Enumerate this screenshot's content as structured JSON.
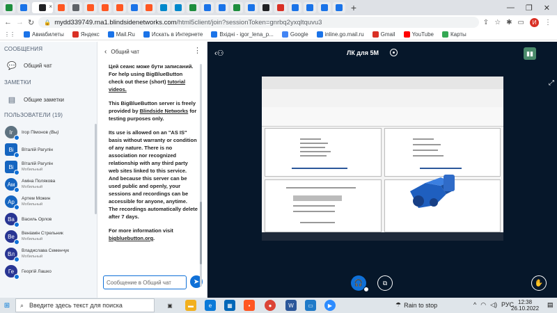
{
  "browser": {
    "url_host": "mydd339749.rna1.blindsidenetworks.com",
    "url_path": "/html5client/join?sessionToken=gnrbq2yxqltquvu3",
    "bookmarks": [
      "Авиабилеты",
      "Яндекс",
      "Mail.Ru",
      "Искать в Интернете",
      "Вхідні - igor_lena_p...",
      "Google",
      "inline.go.mail.ru",
      "Gmail",
      "YouTube",
      "Карты"
    ],
    "profile_initial": "И",
    "tab_colors": [
      "#1e8e3e",
      "#1a73e8",
      "#202124",
      "#ff5722",
      "#5f6368",
      "#ff5722",
      "#ff5722",
      "#ff5722",
      "#1a73e8",
      "#ff5722",
      "#0088cc",
      "#0088cc",
      "#1e8e3e",
      "#1a73e8",
      "#1a73e8",
      "#1e8e3e",
      "#1a73e8",
      "#202124",
      "#d93025",
      "#1a73e8",
      "#1a73e8",
      "#1a73e8",
      "#1a73e8"
    ]
  },
  "sidebar": {
    "messages_header": "СООБЩЕНИЯ",
    "public_chat_label": "Общий чат",
    "notes_header": "ЗАМЕТКИ",
    "shared_notes_label": "Общие заметки",
    "users_header": "ПОЛЬЗОВАТЕЛИ (19)",
    "users": [
      {
        "initials": "Ir",
        "name": "Ігор Пімонов",
        "you": "(Вы)",
        "sub": "",
        "color": "#5e7280",
        "square": false
      },
      {
        "initials": "Ві",
        "name": "Віталій Рагулін",
        "sub": "",
        "color": "#1565c0",
        "square": true
      },
      {
        "initials": "Ві",
        "name": "Віталій Рагулін",
        "sub": "Мобильный",
        "color": "#1565c0",
        "square": true
      },
      {
        "initials": "Ам",
        "name": "Аміна Полякова",
        "sub": "Мобильный",
        "color": "#1565c0",
        "square": false
      },
      {
        "initials": "Ар",
        "name": "Артем Можин",
        "sub": "Мобильный",
        "color": "#1565c0",
        "square": false
      },
      {
        "initials": "Ва",
        "name": "Василь Орлов",
        "sub": "",
        "color": "#283593",
        "square": false
      },
      {
        "initials": "Ве",
        "name": "Веніамін Стрельник",
        "sub": "Мобильный",
        "color": "#283593",
        "square": false
      },
      {
        "initials": "Вл",
        "name": "Владислава Семенчук",
        "sub": "Мобильный",
        "color": "#283593",
        "square": false
      },
      {
        "initials": "Ге",
        "name": "Георгій Лашко",
        "sub": "",
        "color": "#283593",
        "square": false
      }
    ]
  },
  "chat": {
    "title": "Общий чат",
    "msg_line1": "Цей сеанс може бути записаний.",
    "msg_line1b": "For help using BigBlueButton check out these (short)",
    "tutorial_link": "tutorial videos.",
    "msg2a": "This BigBlueButton server is freely provided by",
    "blindside_link": "Blindside Networks",
    "msg2b": "for testing purposes only.",
    "msg3": "Its use is allowed on an \"AS IS\" basis without warranty or condition of any nature. There is no association nor recognized relationship with any third party web sites linked to this service. And because this server can be used public and openly, your sessions and recordings can be accessible for anyone, anytime. The recordings automatically delete after 7 days.",
    "msg4": "For more information visit",
    "bbb_link": "bigbluebutton.org",
    "input_placeholder": "Сообщение в Общий чат"
  },
  "main": {
    "room_name": "ЛК для 5М"
  },
  "taskbar": {
    "search_placeholder": "Введите здесь текст для поиска",
    "weather": "Rain to stop",
    "lang": "РУС",
    "time": "12:38",
    "date": "26.10.2022"
  }
}
